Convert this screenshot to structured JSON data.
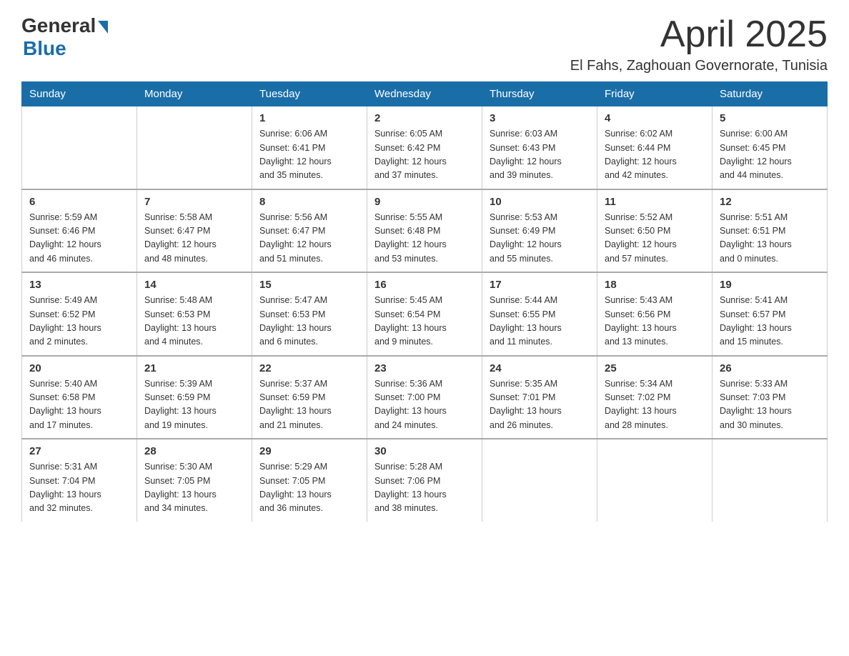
{
  "logo": {
    "general": "General",
    "blue": "Blue"
  },
  "title": "April 2025",
  "location": "El Fahs, Zaghouan Governorate, Tunisia",
  "weekdays": [
    "Sunday",
    "Monday",
    "Tuesday",
    "Wednesday",
    "Thursday",
    "Friday",
    "Saturday"
  ],
  "weeks": [
    [
      {
        "day": "",
        "info": ""
      },
      {
        "day": "",
        "info": ""
      },
      {
        "day": "1",
        "info": "Sunrise: 6:06 AM\nSunset: 6:41 PM\nDaylight: 12 hours\nand 35 minutes."
      },
      {
        "day": "2",
        "info": "Sunrise: 6:05 AM\nSunset: 6:42 PM\nDaylight: 12 hours\nand 37 minutes."
      },
      {
        "day": "3",
        "info": "Sunrise: 6:03 AM\nSunset: 6:43 PM\nDaylight: 12 hours\nand 39 minutes."
      },
      {
        "day": "4",
        "info": "Sunrise: 6:02 AM\nSunset: 6:44 PM\nDaylight: 12 hours\nand 42 minutes."
      },
      {
        "day": "5",
        "info": "Sunrise: 6:00 AM\nSunset: 6:45 PM\nDaylight: 12 hours\nand 44 minutes."
      }
    ],
    [
      {
        "day": "6",
        "info": "Sunrise: 5:59 AM\nSunset: 6:46 PM\nDaylight: 12 hours\nand 46 minutes."
      },
      {
        "day": "7",
        "info": "Sunrise: 5:58 AM\nSunset: 6:47 PM\nDaylight: 12 hours\nand 48 minutes."
      },
      {
        "day": "8",
        "info": "Sunrise: 5:56 AM\nSunset: 6:47 PM\nDaylight: 12 hours\nand 51 minutes."
      },
      {
        "day": "9",
        "info": "Sunrise: 5:55 AM\nSunset: 6:48 PM\nDaylight: 12 hours\nand 53 minutes."
      },
      {
        "day": "10",
        "info": "Sunrise: 5:53 AM\nSunset: 6:49 PM\nDaylight: 12 hours\nand 55 minutes."
      },
      {
        "day": "11",
        "info": "Sunrise: 5:52 AM\nSunset: 6:50 PM\nDaylight: 12 hours\nand 57 minutes."
      },
      {
        "day": "12",
        "info": "Sunrise: 5:51 AM\nSunset: 6:51 PM\nDaylight: 13 hours\nand 0 minutes."
      }
    ],
    [
      {
        "day": "13",
        "info": "Sunrise: 5:49 AM\nSunset: 6:52 PM\nDaylight: 13 hours\nand 2 minutes."
      },
      {
        "day": "14",
        "info": "Sunrise: 5:48 AM\nSunset: 6:53 PM\nDaylight: 13 hours\nand 4 minutes."
      },
      {
        "day": "15",
        "info": "Sunrise: 5:47 AM\nSunset: 6:53 PM\nDaylight: 13 hours\nand 6 minutes."
      },
      {
        "day": "16",
        "info": "Sunrise: 5:45 AM\nSunset: 6:54 PM\nDaylight: 13 hours\nand 9 minutes."
      },
      {
        "day": "17",
        "info": "Sunrise: 5:44 AM\nSunset: 6:55 PM\nDaylight: 13 hours\nand 11 minutes."
      },
      {
        "day": "18",
        "info": "Sunrise: 5:43 AM\nSunset: 6:56 PM\nDaylight: 13 hours\nand 13 minutes."
      },
      {
        "day": "19",
        "info": "Sunrise: 5:41 AM\nSunset: 6:57 PM\nDaylight: 13 hours\nand 15 minutes."
      }
    ],
    [
      {
        "day": "20",
        "info": "Sunrise: 5:40 AM\nSunset: 6:58 PM\nDaylight: 13 hours\nand 17 minutes."
      },
      {
        "day": "21",
        "info": "Sunrise: 5:39 AM\nSunset: 6:59 PM\nDaylight: 13 hours\nand 19 minutes."
      },
      {
        "day": "22",
        "info": "Sunrise: 5:37 AM\nSunset: 6:59 PM\nDaylight: 13 hours\nand 21 minutes."
      },
      {
        "day": "23",
        "info": "Sunrise: 5:36 AM\nSunset: 7:00 PM\nDaylight: 13 hours\nand 24 minutes."
      },
      {
        "day": "24",
        "info": "Sunrise: 5:35 AM\nSunset: 7:01 PM\nDaylight: 13 hours\nand 26 minutes."
      },
      {
        "day": "25",
        "info": "Sunrise: 5:34 AM\nSunset: 7:02 PM\nDaylight: 13 hours\nand 28 minutes."
      },
      {
        "day": "26",
        "info": "Sunrise: 5:33 AM\nSunset: 7:03 PM\nDaylight: 13 hours\nand 30 minutes."
      }
    ],
    [
      {
        "day": "27",
        "info": "Sunrise: 5:31 AM\nSunset: 7:04 PM\nDaylight: 13 hours\nand 32 minutes."
      },
      {
        "day": "28",
        "info": "Sunrise: 5:30 AM\nSunset: 7:05 PM\nDaylight: 13 hours\nand 34 minutes."
      },
      {
        "day": "29",
        "info": "Sunrise: 5:29 AM\nSunset: 7:05 PM\nDaylight: 13 hours\nand 36 minutes."
      },
      {
        "day": "30",
        "info": "Sunrise: 5:28 AM\nSunset: 7:06 PM\nDaylight: 13 hours\nand 38 minutes."
      },
      {
        "day": "",
        "info": ""
      },
      {
        "day": "",
        "info": ""
      },
      {
        "day": "",
        "info": ""
      }
    ]
  ]
}
